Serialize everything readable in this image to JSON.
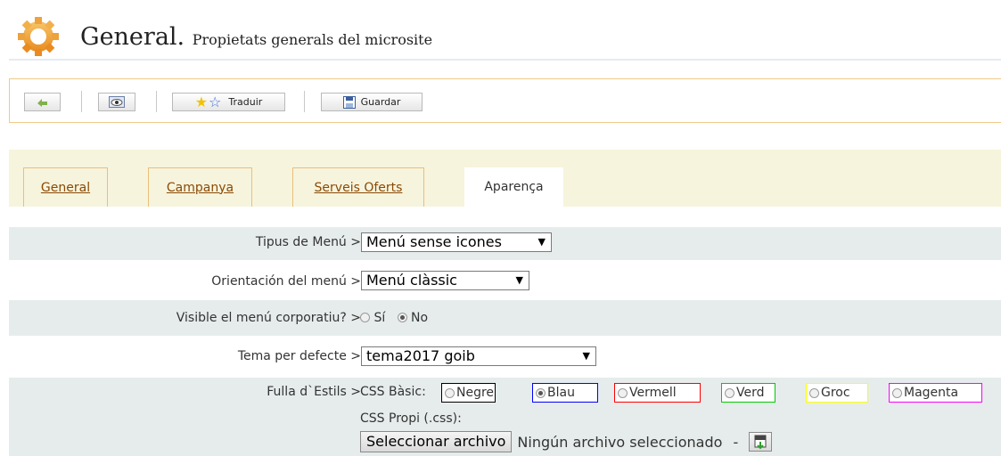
{
  "header": {
    "title": "General.",
    "subtitle": "Propietats generals del microsite"
  },
  "toolbar": {
    "back_icon": "back-arrow-icon",
    "preview_icon": "eye-icon",
    "translate_label": "Traduir",
    "save_label": "Guardar"
  },
  "tabs": [
    {
      "label": "General",
      "active": false
    },
    {
      "label": "Campanya",
      "active": false
    },
    {
      "label": "Serveis Oferts",
      "active": false
    },
    {
      "label": "Aparença",
      "active": true
    }
  ],
  "form": {
    "menu_type": {
      "label": "Tipus de Menú >",
      "value": "Menú sense icones"
    },
    "menu_orientation": {
      "label": "Orientación del menú >",
      "value": "Menú clàssic"
    },
    "corporate_menu": {
      "label": "Visible el menú corporatiu? >",
      "options": [
        "Sí",
        "No"
      ],
      "selected": "No"
    },
    "default_theme": {
      "label": "Tema per defecte >",
      "value": "tema2017 goib"
    },
    "stylesheet": {
      "label": "Fulla d`Estils >",
      "basic_label": "CSS Bàsic:",
      "options": [
        {
          "label": "Negre",
          "color": "#000000",
          "selected": false
        },
        {
          "label": "Blau",
          "color": "#0000ff",
          "selected": true
        },
        {
          "label": "Vermell",
          "color": "#ff0000",
          "selected": false
        },
        {
          "label": "Verd",
          "color": "#00cc00",
          "selected": false
        },
        {
          "label": "Groc",
          "color": "#ffff00",
          "selected": false
        },
        {
          "label": "Magenta",
          "color": "#ff00ff",
          "selected": false
        }
      ]
    },
    "custom_css": {
      "label": "CSS Propi (.css):",
      "button_label": "Seleccionar archivo",
      "status": "Ningún archivo seleccionado",
      "separator": "-",
      "icon": "css-file-icon"
    }
  },
  "colors": {
    "accent_border": "#f0c98a",
    "tab_strip": "#f7f4dd",
    "tab_text": "#8a4a05",
    "row_shade": "#e6ecec"
  }
}
